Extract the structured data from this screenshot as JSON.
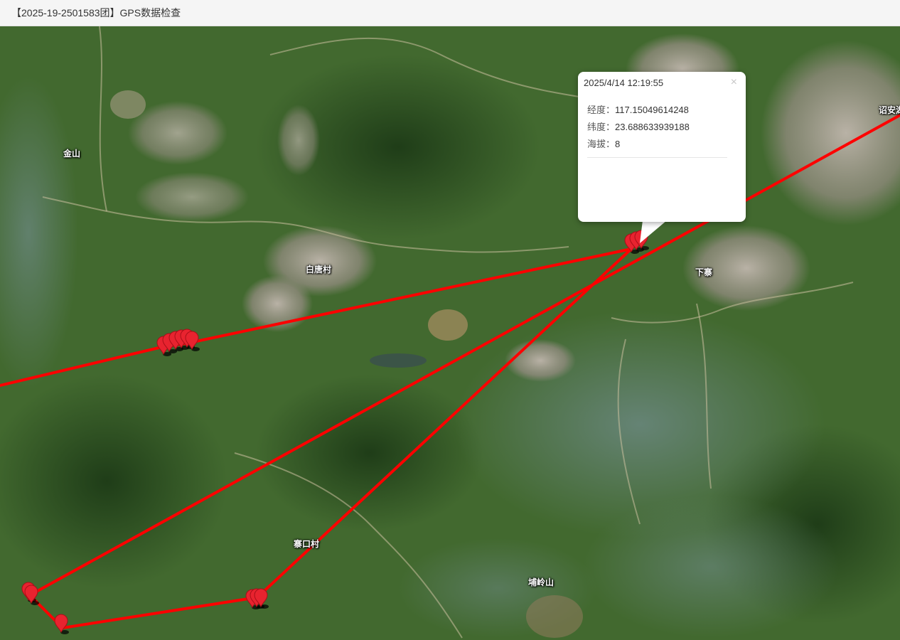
{
  "title": "【2025-19-2501583团】GPS数据检查",
  "map": {
    "route_color": "#ff0000",
    "marker_color": "#e8232f",
    "place_labels": [
      "金山",
      "白唐村",
      "下寨",
      "诏安湖",
      "寨口村",
      "埔岭山"
    ]
  },
  "popup": {
    "time": "2025/4/14 12:19:55",
    "close_symbol": "×",
    "longitude_label": "经度：",
    "longitude_value": "117.15049614248",
    "latitude_label": "纬度：",
    "latitude_value": "23.688633939188",
    "altitude_label": "海拔：",
    "altitude_value": "8"
  }
}
